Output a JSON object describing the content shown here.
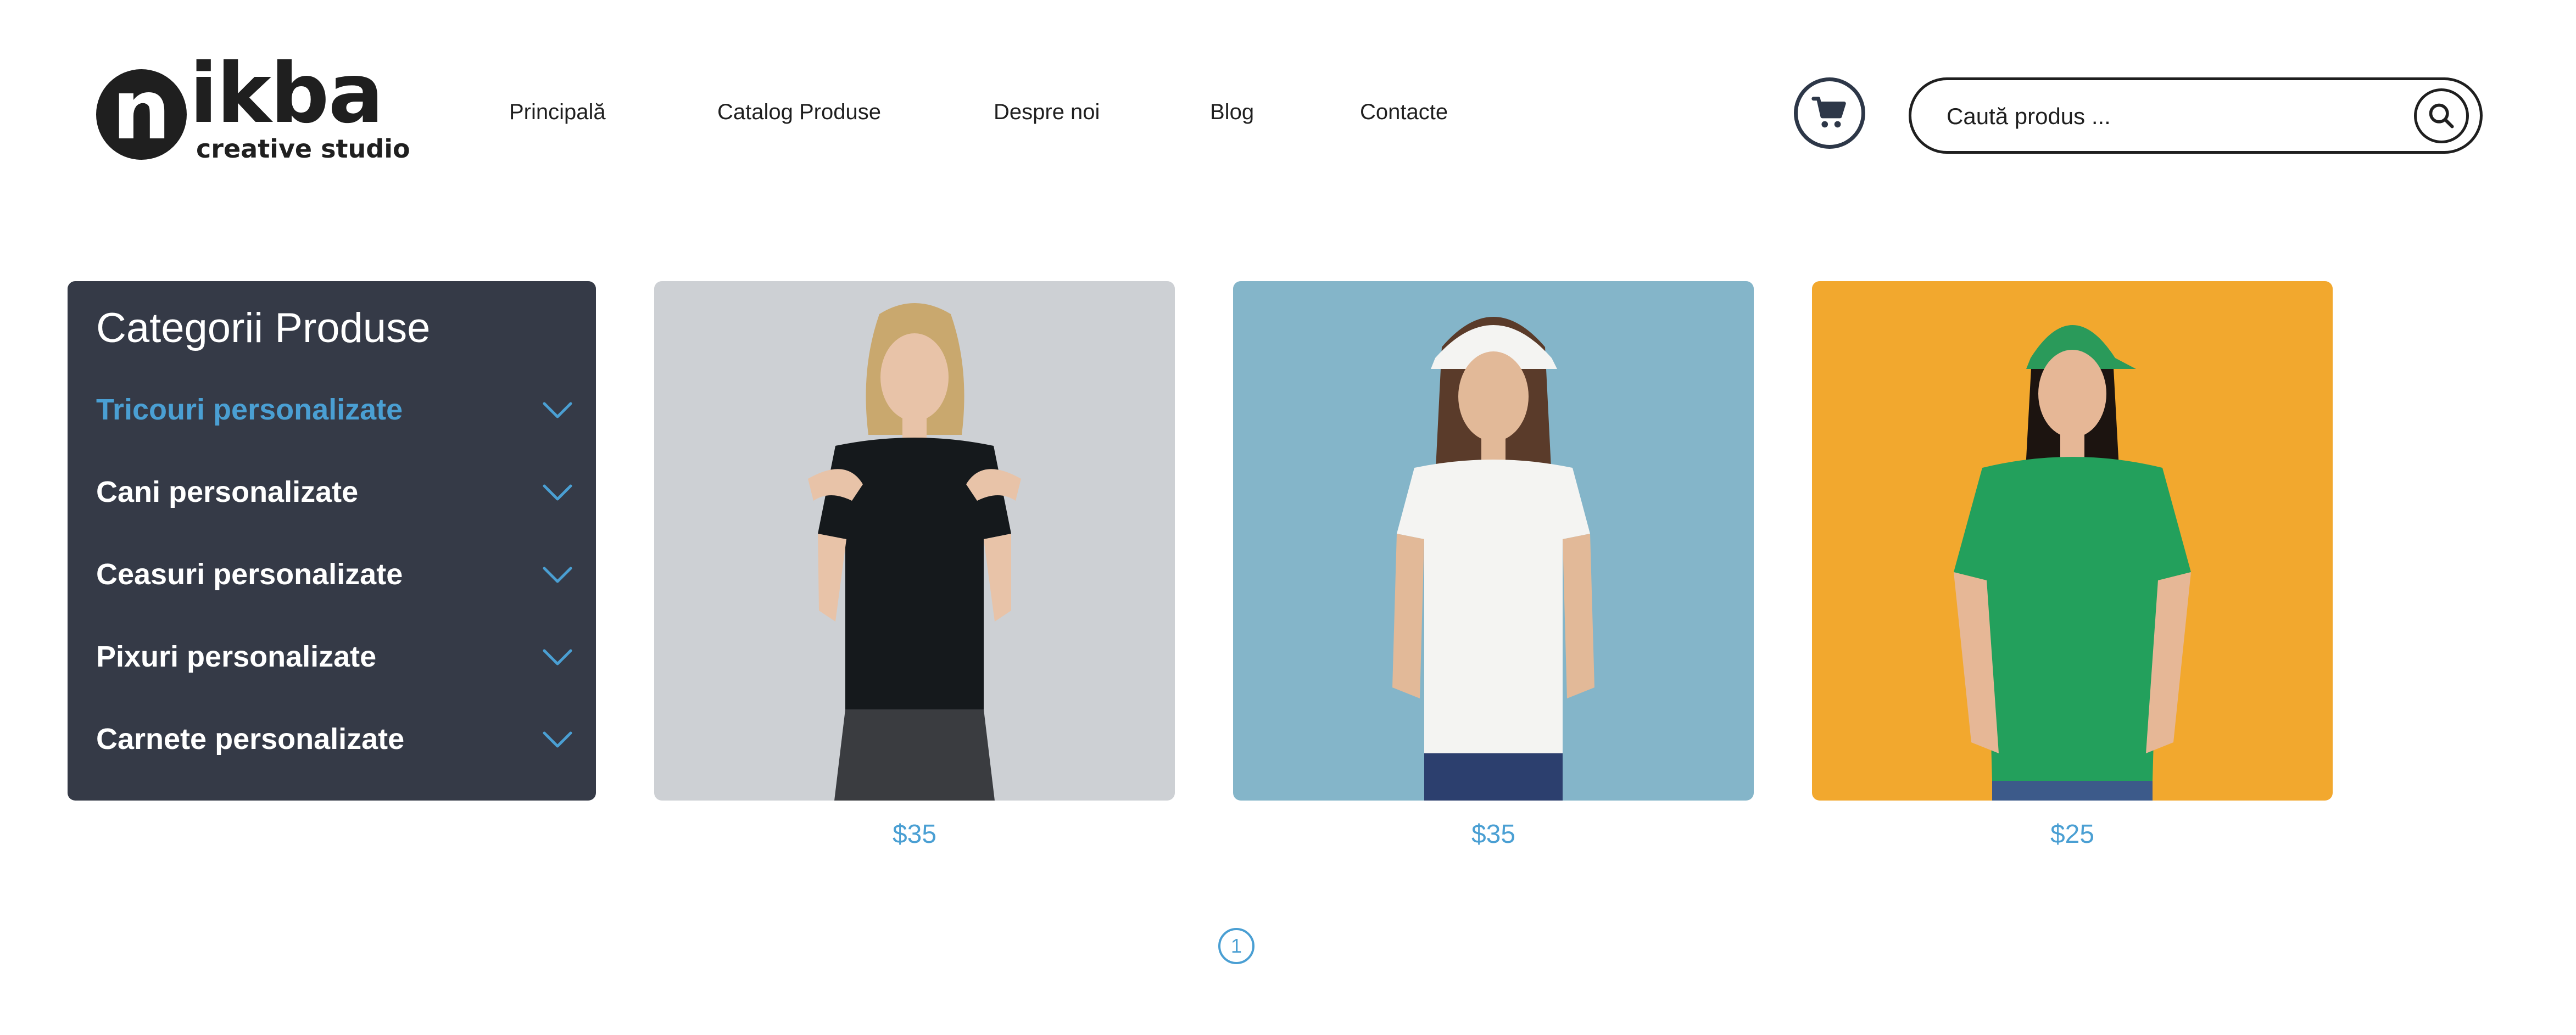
{
  "brand": {
    "logo_letter": "n",
    "logo_word": "ikba",
    "logo_sub": "creative studio"
  },
  "nav": [
    {
      "label": "Principală"
    },
    {
      "label": "Catalog Produse"
    },
    {
      "label": "Despre noi"
    },
    {
      "label": "Blog"
    },
    {
      "label": "Contacte"
    }
  ],
  "search": {
    "placeholder": "Caută produs ..."
  },
  "icons": {
    "cart": "cart-icon",
    "search": "search-icon",
    "chevron": "chevron-down-icon"
  },
  "sidebar": {
    "title": "Categorii Produse",
    "items": [
      {
        "label": "Tricouri personalizate",
        "active": true
      },
      {
        "label": "Cani personalizate"
      },
      {
        "label": "Ceasuri personalizate"
      },
      {
        "label": "Pixuri personalizate"
      },
      {
        "label": "Carnete personalizate"
      }
    ]
  },
  "products": [
    {
      "price": "$35",
      "image": "woman in black t-shirt on grey background"
    },
    {
      "price": "$35",
      "image": "woman in white t-shirt and white cap on blue background"
    },
    {
      "price": "$25",
      "image": "woman in green t-shirt and green cap on yellow background"
    }
  ],
  "pagination": {
    "current": "1"
  },
  "colors": {
    "accent": "#4a9fd3",
    "sidebar_bg": "#353a47",
    "text": "#1f1f1f"
  }
}
